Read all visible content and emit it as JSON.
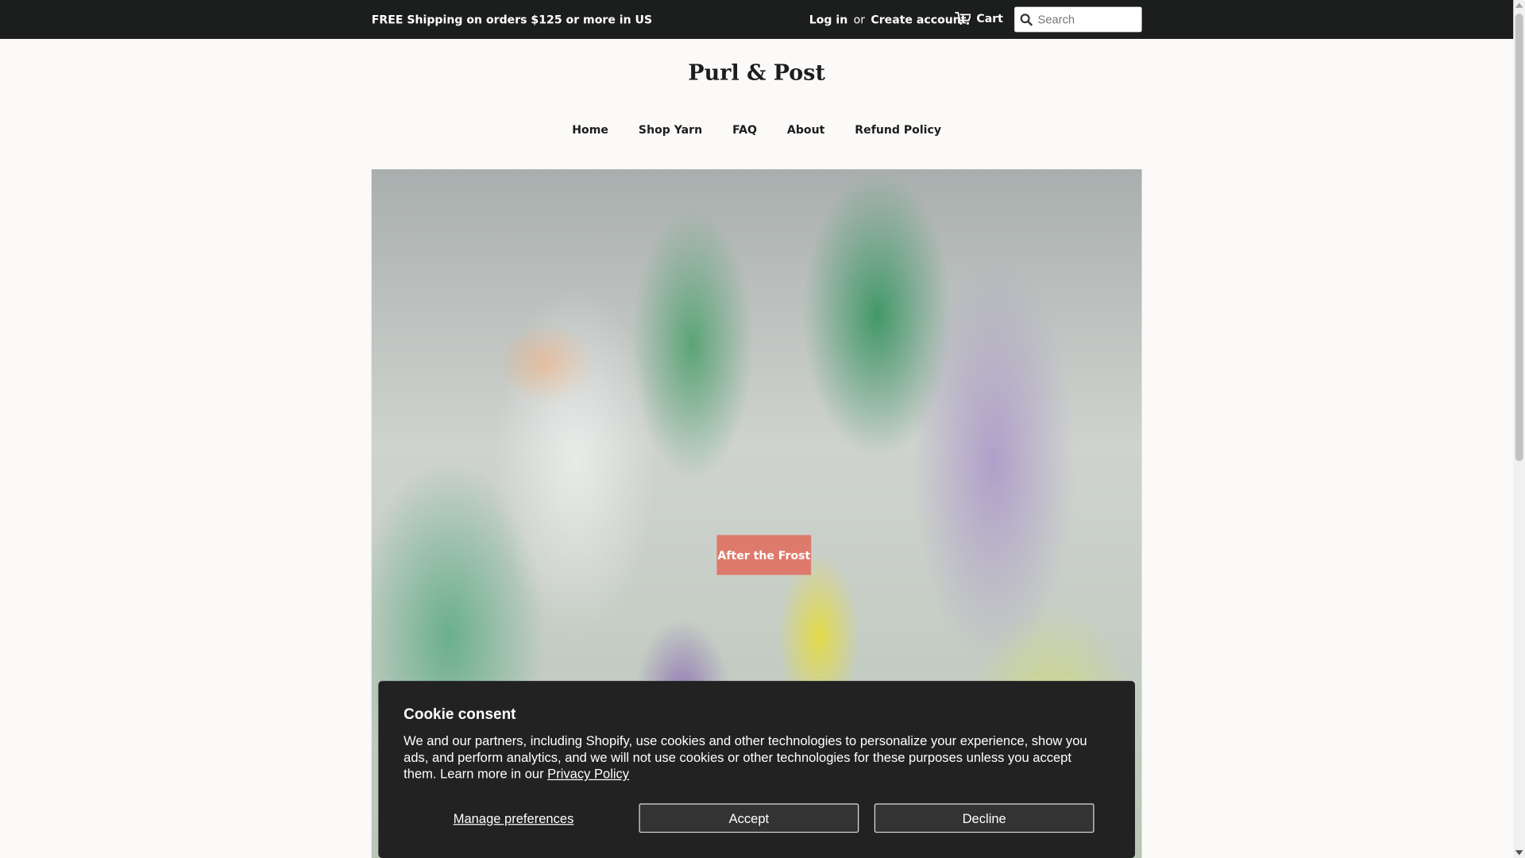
{
  "topbar": {
    "promo": "FREE Shipping on orders $125 or more in US",
    "login": "Log in",
    "or": "or",
    "create_account": "Create account",
    "cart": "Cart",
    "search_placeholder": "Search"
  },
  "logo": "Purl & Post",
  "nav": [
    "Home",
    "Shop Yarn",
    "FAQ",
    "About",
    "Refund Policy"
  ],
  "hero": {
    "button": "After the Frost"
  },
  "cookie": {
    "title": "Cookie consent",
    "body": "We and our partners, including Shopify, use cookies and other technologies to personalize your experience, show you ads, and perform analytics, and we will not use cookies or other technologies for these purposes unless you accept them. Learn more in our ",
    "privacy_link": "Privacy Policy",
    "manage": "Manage preferences",
    "accept": "Accept",
    "decline": "Decline"
  },
  "colors": {
    "topbar": "#1c1d1d",
    "hero_button": "#de7a6c",
    "cookie_bg": "#222222"
  }
}
